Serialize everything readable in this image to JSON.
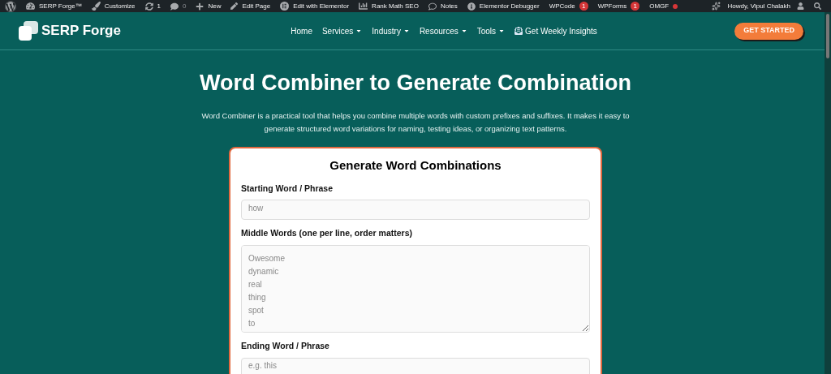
{
  "admin_bar": {
    "items": [
      {
        "kind": "wp-logo"
      },
      {
        "kind": "site",
        "label": "SERP Forge™"
      },
      {
        "kind": "customize",
        "label": "Customize"
      },
      {
        "kind": "updates",
        "label": "1"
      },
      {
        "kind": "comments",
        "label": "0"
      },
      {
        "kind": "new",
        "label": "New"
      },
      {
        "kind": "edit",
        "label": "Edit Page"
      },
      {
        "kind": "elementor",
        "label": "Edit with Elementor"
      },
      {
        "kind": "rankmath",
        "label": "Rank Math SEO"
      },
      {
        "kind": "notes",
        "label": "Notes"
      },
      {
        "kind": "info",
        "label": "Elementor Debugger"
      },
      {
        "kind": "plain",
        "label": "WPCode",
        "badge": "1",
        "alert": false
      },
      {
        "kind": "plain",
        "label": "WPForms",
        "badge": "1",
        "alert": false
      },
      {
        "kind": "plain",
        "label": "OMGF",
        "alert": true
      }
    ],
    "greeting": "Howdy, Vipul Chalakh"
  },
  "header": {
    "logo": "SERP Forge",
    "nav": [
      {
        "label": "Home",
        "kind": "link",
        "dropdown": false
      },
      {
        "label": "Services",
        "kind": "link",
        "dropdown": true
      },
      {
        "label": "Industry",
        "kind": "link",
        "dropdown": true
      },
      {
        "label": "Resources",
        "kind": "link",
        "dropdown": true
      },
      {
        "label": "Tools",
        "kind": "link",
        "dropdown": true
      },
      {
        "label": "Get Weekly Insights",
        "kind": "newsletter",
        "dropdown": false
      }
    ],
    "cta": "GET STARTED"
  },
  "hero": {
    "title": "Word Combiner to Generate Combination",
    "intro": "Word Combiner is a practical tool that helps you combine multiple words with custom prefixes and suffixes. It makes it easy to generate structured word variations for naming, testing ideas, or organizing text patterns."
  },
  "form": {
    "title": "Generate Word Combinations",
    "fields": [
      {
        "kind": "input",
        "label": "Starting Word / Phrase",
        "placeholder": "how"
      },
      {
        "kind": "textarea",
        "label": "Middle Words (one per line, order matters)",
        "placeholder": "Owesome\ndynamic\nreal\nthing\nspot\nto"
      },
      {
        "kind": "input",
        "label": "Ending Word / Phrase",
        "placeholder": "e.g. this"
      }
    ]
  }
}
